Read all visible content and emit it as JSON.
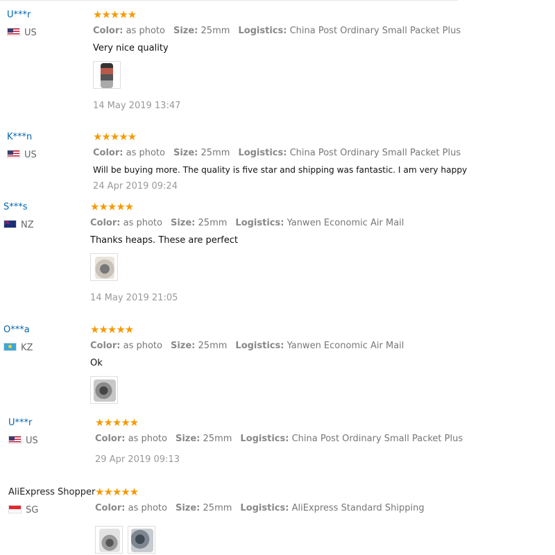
{
  "star_glyph": "★★★★★",
  "labels": {
    "color": "Color:",
    "size": "Size:",
    "logistics": "Logistics:"
  },
  "reviews": [
    {
      "user": "U***r",
      "country": "US",
      "flag_icon": "us-flag-icon",
      "rating": 5,
      "color": "as photo",
      "size": "25mm",
      "logistics": "China Post Ordinary Small Packet Plus",
      "text": "Very nice quality",
      "photos": 1,
      "date": "14 May 2019 13:47"
    },
    {
      "user": "K***n",
      "country": "US",
      "flag_icon": "us-flag-icon",
      "rating": 5,
      "color": "as photo",
      "size": "25mm",
      "logistics": "China Post Ordinary Small Packet Plus",
      "text": "Will be buying more. The quality is five star and shipping was fantastic. I am very happy",
      "photos": 0,
      "date": "24 Apr 2019 09:24"
    },
    {
      "user": "S***s",
      "country": "NZ",
      "flag_icon": "nz-flag-icon",
      "rating": 5,
      "color": "as photo",
      "size": "25mm",
      "logistics": "Yanwen Economic Air Mail",
      "text": "Thanks heaps. These are perfect",
      "photos": 1,
      "date": "14 May 2019 21:05"
    },
    {
      "user": "O***a",
      "country": "KZ",
      "flag_icon": "kz-flag-icon",
      "rating": 5,
      "color": "as photo",
      "size": "25mm",
      "logistics": "Yanwen Economic Air Mail",
      "text": "Ok",
      "photos": 1,
      "date": ""
    },
    {
      "user": "U***r",
      "country": "US",
      "flag_icon": "us-flag-icon",
      "rating": 5,
      "color": "as photo",
      "size": "25mm",
      "logistics": "China Post Ordinary Small Packet Plus",
      "text": "",
      "photos": 0,
      "date": "29 Apr 2019 09:13"
    },
    {
      "user": "AliExpress Shopper",
      "country": "SG",
      "flag_icon": "sg-flag-icon",
      "rating": 5,
      "color": "as photo",
      "size": "25mm",
      "logistics": "AliExpress Standard Shipping",
      "text": "",
      "photos": 2,
      "date": ""
    }
  ]
}
